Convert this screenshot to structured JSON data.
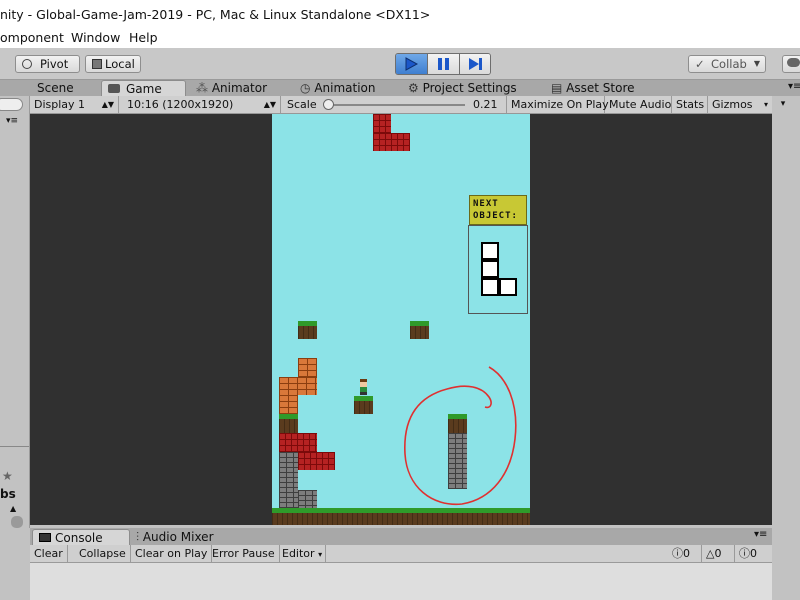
{
  "window": {
    "title": "nity - Global-Game-Jam-2019 - PC, Mac & Linux Standalone <DX11>"
  },
  "menu": {
    "items": [
      "omponent",
      "Window",
      "Help"
    ]
  },
  "toolbar": {
    "pivot": "Pivot",
    "local": "Local",
    "collab": "Collab"
  },
  "tabs": {
    "scene": "Scene",
    "game": "Game",
    "animator": "Animator",
    "animation": "Animation",
    "project_settings": "Project Settings",
    "asset_store": "Asset Store"
  },
  "gamebar": {
    "display": "Display 1",
    "resolution": "10:16 (1200x1920)",
    "scale_label": "Scale",
    "scale_value": "0.21",
    "maximize": "Maximize On Play",
    "mute": "Mute Audio",
    "stats": "Stats",
    "gizmos": "Gizmos"
  },
  "left_panel": {
    "label": "bs"
  },
  "game": {
    "next_label_line1": "NEXT",
    "next_label_line2": "OBJECT:"
  },
  "console": {
    "tab_console": "Console",
    "tab_audio_mixer": "Audio Mixer",
    "clear": "Clear",
    "collapse": "Collapse",
    "clear_on_play": "Clear on Play",
    "error_pause": "Error Pause",
    "editor": "Editor",
    "log_count": "0",
    "warning_count": "0",
    "error_count": "0"
  },
  "colors": {
    "accent_play": "#3f7fd0",
    "game_sky": "#8ce3e7",
    "annotation": "#e03030"
  }
}
